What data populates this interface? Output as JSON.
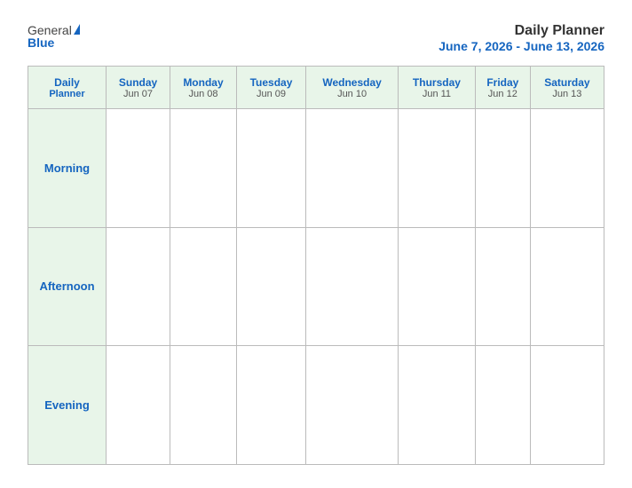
{
  "logo": {
    "general": "General",
    "blue": "Blue"
  },
  "title": {
    "main": "Daily Planner",
    "dates": "June 7, 2026 - June 13, 2026"
  },
  "columns": {
    "label": {
      "name": "Daily",
      "sub": "Planner"
    },
    "days": [
      {
        "name": "Sunday",
        "date": "Jun 07"
      },
      {
        "name": "Monday",
        "date": "Jun 08"
      },
      {
        "name": "Tuesday",
        "date": "Jun 09"
      },
      {
        "name": "Wednesday",
        "date": "Jun 10"
      },
      {
        "name": "Thursday",
        "date": "Jun 11"
      },
      {
        "name": "Friday",
        "date": "Jun 12"
      },
      {
        "name": "Saturday",
        "date": "Jun 13"
      }
    ]
  },
  "rows": [
    {
      "label": "Morning"
    },
    {
      "label": "Afternoon"
    },
    {
      "label": "Evening"
    }
  ]
}
